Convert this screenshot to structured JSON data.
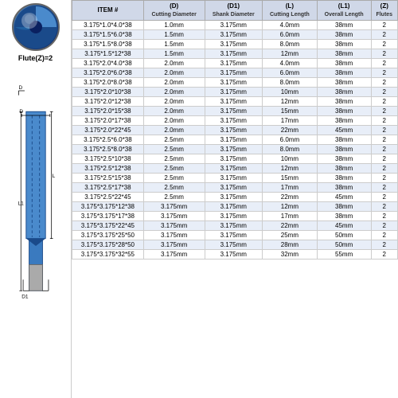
{
  "header": {
    "item_col": "ITEM #",
    "d_label": "(D)",
    "d_sub": "Cutting Diameter",
    "d1_label": "(D1)",
    "d1_sub": "Shank Diameter",
    "l_label": "(L)",
    "l_sub": "Cutting Length",
    "l1_label": "(L1)",
    "l1_sub": "Overall Length",
    "z_label": "(Z)",
    "z_sub": "Flutes"
  },
  "flute_label": "Flute(Z)=2",
  "rows": [
    {
      "item": "3.175*1.0*4.0*38",
      "d": "1.0mm",
      "d1": "3.175mm",
      "l": "4.0mm",
      "l1": "38mm",
      "z": "2"
    },
    {
      "item": "3.175*1.5*6.0*38",
      "d": "1.5mm",
      "d1": "3.175mm",
      "l": "6.0mm",
      "l1": "38mm",
      "z": "2"
    },
    {
      "item": "3.175*1.5*8.0*38",
      "d": "1.5mm",
      "d1": "3.175mm",
      "l": "8.0mm",
      "l1": "38mm",
      "z": "2"
    },
    {
      "item": "3.175*1.5*12*38",
      "d": "1.5mm",
      "d1": "3.175mm",
      "l": "12mm",
      "l1": "38mm",
      "z": "2"
    },
    {
      "item": "3.175*2.0*4.0*38",
      "d": "2.0mm",
      "d1": "3.175mm",
      "l": "4.0mm",
      "l1": "38mm",
      "z": "2"
    },
    {
      "item": "3.175*2.0*6.0*38",
      "d": "2.0mm",
      "d1": "3.175mm",
      "l": "6.0mm",
      "l1": "38mm",
      "z": "2"
    },
    {
      "item": "3.175*2.0*8.0*38",
      "d": "2.0mm",
      "d1": "3.175mm",
      "l": "8.0mm",
      "l1": "38mm",
      "z": "2"
    },
    {
      "item": "3.175*2.0*10*38",
      "d": "2.0mm",
      "d1": "3.175mm",
      "l": "10mm",
      "l1": "38mm",
      "z": "2"
    },
    {
      "item": "3.175*2.0*12*38",
      "d": "2.0mm",
      "d1": "3.175mm",
      "l": "12mm",
      "l1": "38mm",
      "z": "2"
    },
    {
      "item": "3.175*2.0*15*38",
      "d": "2.0mm",
      "d1": "3.175mm",
      "l": "15mm",
      "l1": "38mm",
      "z": "2"
    },
    {
      "item": "3.175*2.0*17*38",
      "d": "2.0mm",
      "d1": "3.175mm",
      "l": "17mm",
      "l1": "38mm",
      "z": "2"
    },
    {
      "item": "3.175*2.0*22*45",
      "d": "2.0mm",
      "d1": "3.175mm",
      "l": "22mm",
      "l1": "45mm",
      "z": "2"
    },
    {
      "item": "3.175*2.5*6.0*38",
      "d": "2.5mm",
      "d1": "3.175mm",
      "l": "6.0mm",
      "l1": "38mm",
      "z": "2"
    },
    {
      "item": "3.175*2.5*8.0*38",
      "d": "2.5mm",
      "d1": "3.175mm",
      "l": "8.0mm",
      "l1": "38mm",
      "z": "2"
    },
    {
      "item": "3.175*2.5*10*38",
      "d": "2.5mm",
      "d1": "3.175mm",
      "l": "10mm",
      "l1": "38mm",
      "z": "2"
    },
    {
      "item": "3.175*2.5*12*38",
      "d": "2.5mm",
      "d1": "3.175mm",
      "l": "12mm",
      "l1": "38mm",
      "z": "2"
    },
    {
      "item": "3.175*2.5*15*38",
      "d": "2.5mm",
      "d1": "3.175mm",
      "l": "15mm",
      "l1": "38mm",
      "z": "2"
    },
    {
      "item": "3.175*2.5*17*38",
      "d": "2.5mm",
      "d1": "3.175mm",
      "l": "17mm",
      "l1": "38mm",
      "z": "2"
    },
    {
      "item": "3.175*2.5*22*45",
      "d": "2.5mm",
      "d1": "3.175mm",
      "l": "22mm",
      "l1": "45mm",
      "z": "2"
    },
    {
      "item": "3.175*3.175*12*38",
      "d": "3.175mm",
      "d1": "3.175mm",
      "l": "12mm",
      "l1": "38mm",
      "z": "2"
    },
    {
      "item": "3.175*3.175*17*38",
      "d": "3.175mm",
      "d1": "3.175mm",
      "l": "17mm",
      "l1": "38mm",
      "z": "2"
    },
    {
      "item": "3.175*3.175*22*45",
      "d": "3.175mm",
      "d1": "3.175mm",
      "l": "22mm",
      "l1": "45mm",
      "z": "2"
    },
    {
      "item": "3.175*3.175*25*50",
      "d": "3.175mm",
      "d1": "3.175mm",
      "l": "25mm",
      "l1": "50mm",
      "z": "2"
    },
    {
      "item": "3.175*3.175*28*50",
      "d": "3.175mm",
      "d1": "3.175mm",
      "l": "28mm",
      "l1": "50mm",
      "z": "2"
    },
    {
      "item": "3.175*3.175*32*55",
      "d": "3.175mm",
      "d1": "3.175mm",
      "l": "32mm",
      "l1": "55mm",
      "z": "2"
    }
  ]
}
